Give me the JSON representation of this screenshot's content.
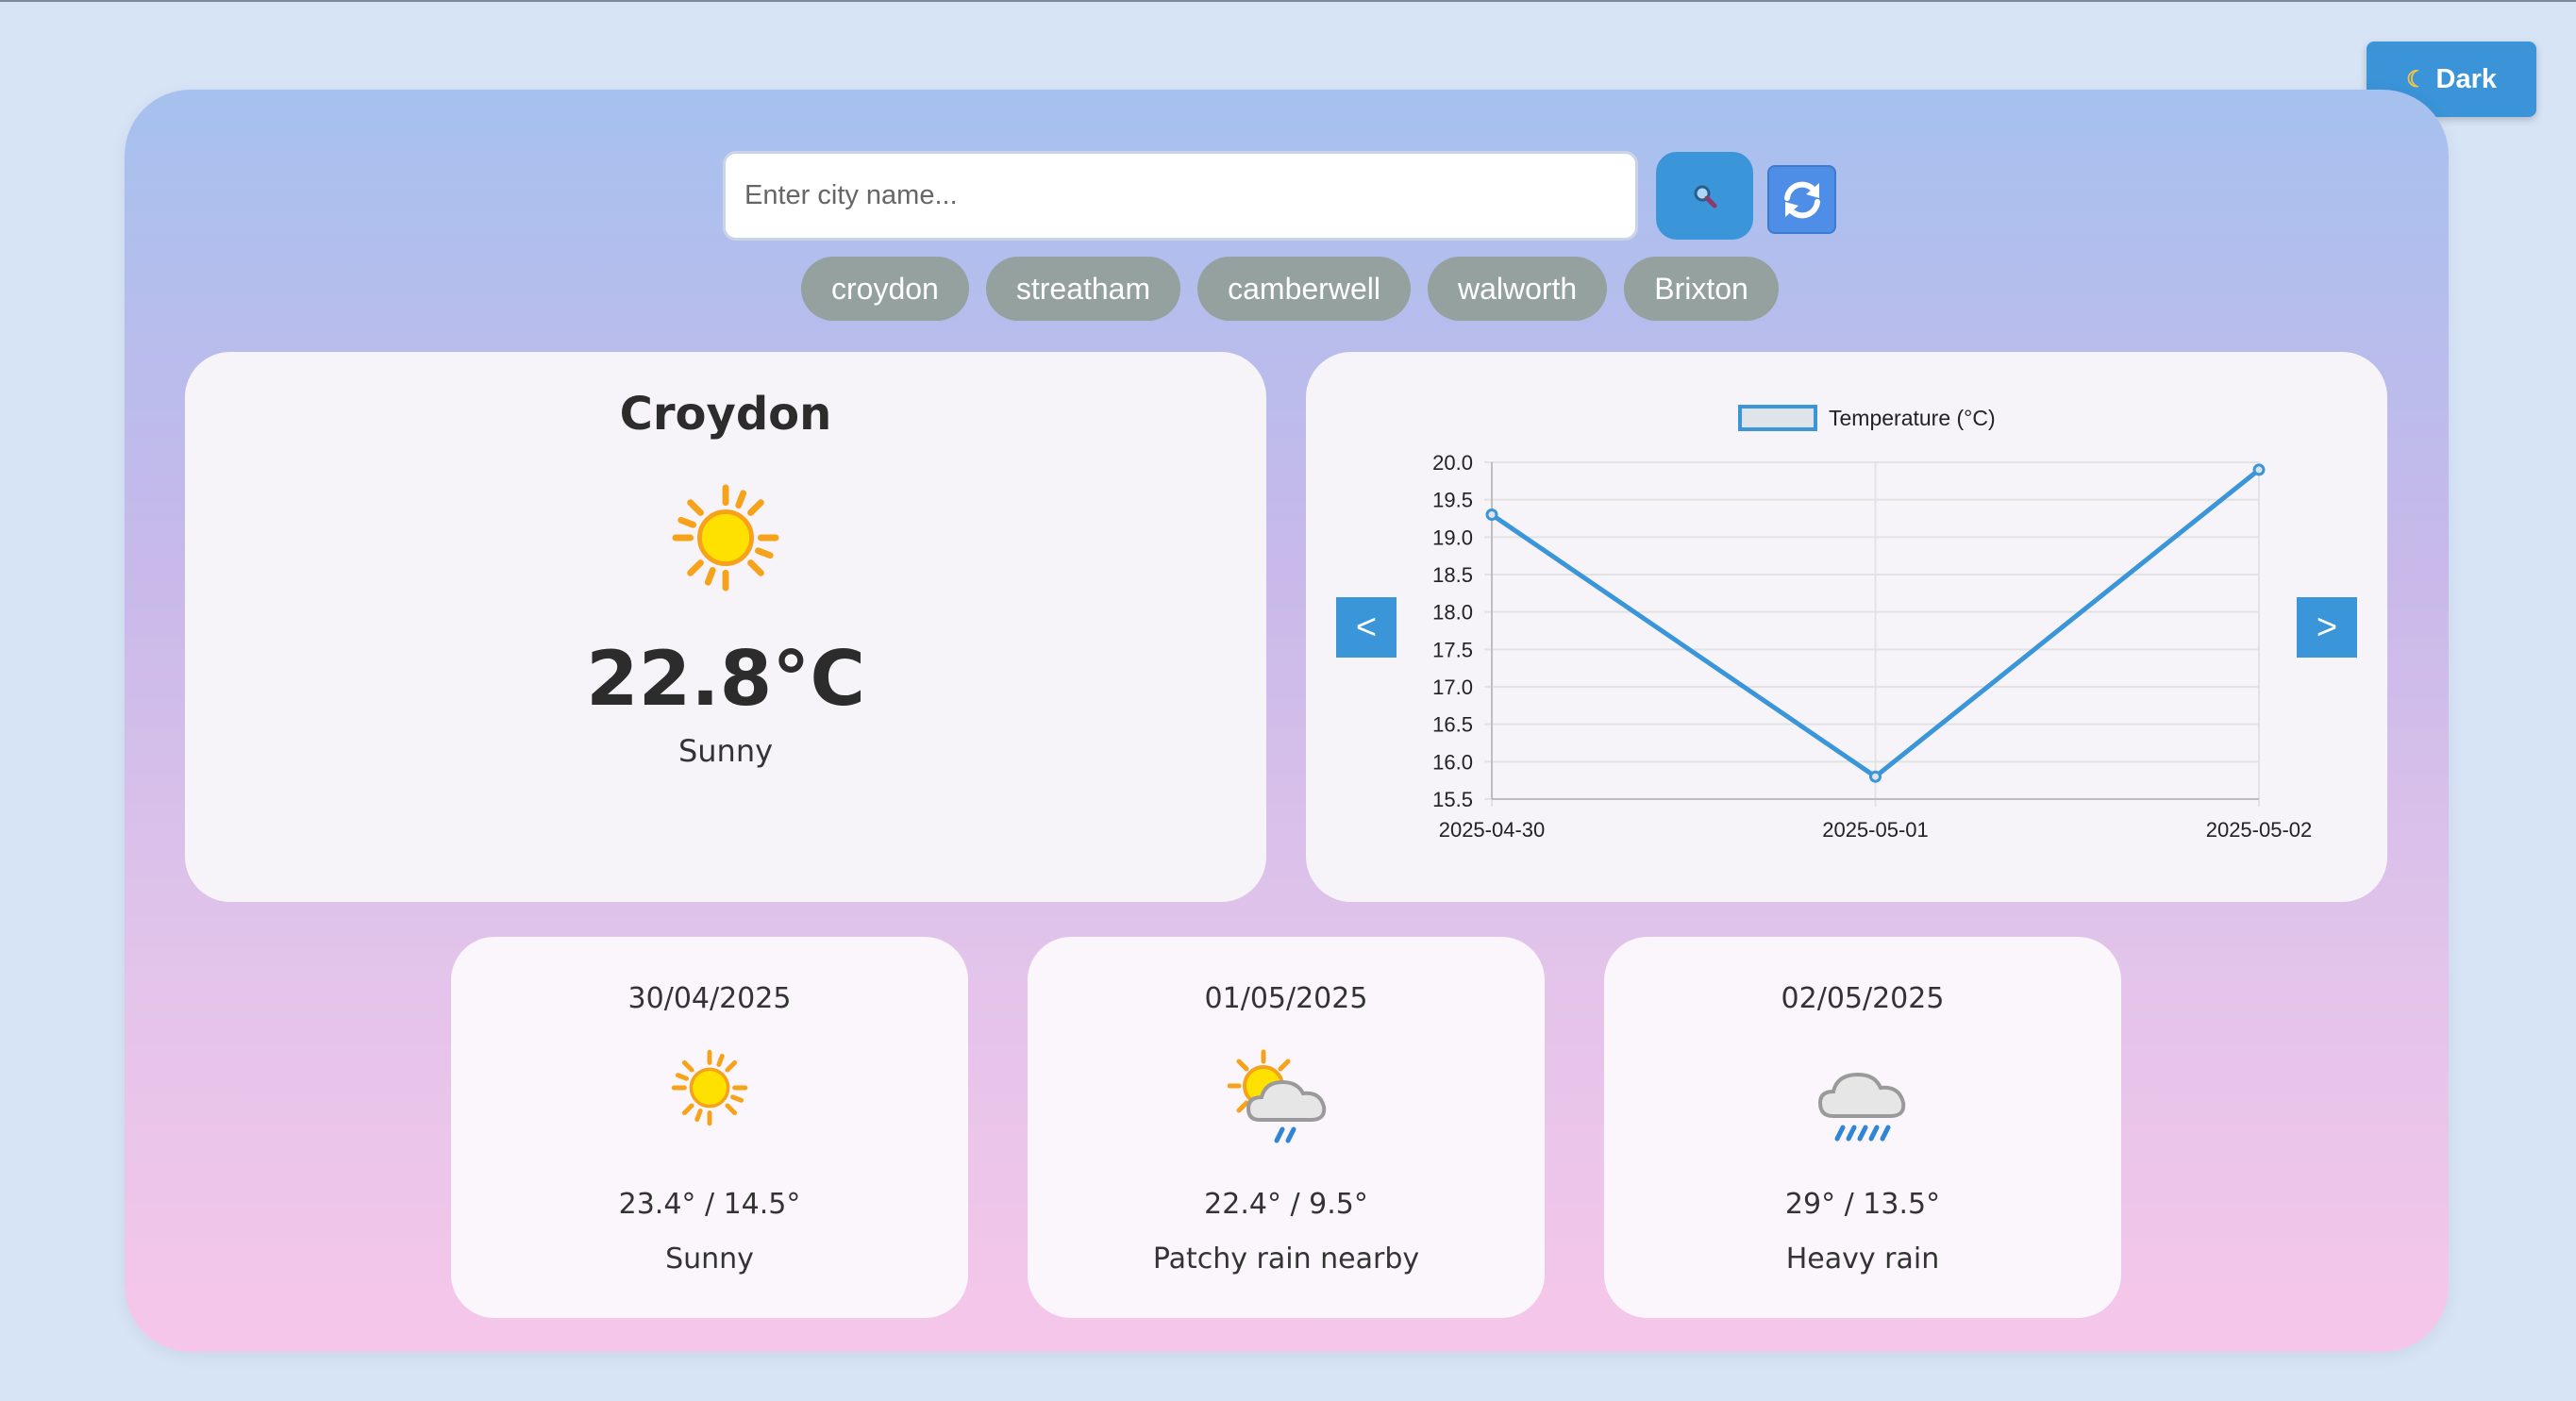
{
  "theme_toggle": {
    "icon": "moon-icon",
    "label": "Dark"
  },
  "search": {
    "placeholder": "Enter city name...",
    "value": "",
    "search_icon": "magnifier-icon",
    "refresh_icon": "refresh-icon"
  },
  "recent_cities": [
    "croydon",
    "streatham",
    "camberwell",
    "walworth",
    "Brixton"
  ],
  "current": {
    "city": "Croydon",
    "icon": "sun-icon",
    "temperature": "22.8°C",
    "condition": "Sunny"
  },
  "chart_nav": {
    "prev": "<",
    "next": ">"
  },
  "chart_data": {
    "type": "line",
    "x": [
      "2025-04-30",
      "2025-05-01",
      "2025-05-02"
    ],
    "series": [
      {
        "name": "Temperature (°C)",
        "values": [
          19.3,
          15.8,
          19.9
        ]
      }
    ],
    "ylim": [
      15.5,
      20.0
    ],
    "yticks": [
      "20.0",
      "19.5",
      "19.0",
      "18.5",
      "18.0",
      "17.5",
      "17.0",
      "16.5",
      "16.0",
      "15.5"
    ],
    "legend": "top",
    "grid": true,
    "colors": {
      "line": "#3a96d8",
      "grid": "#e2e2e2"
    }
  },
  "forecast": [
    {
      "date": "30/04/2025",
      "icon": "sun-icon",
      "temps": "23.4° / 14.5°",
      "condition": "Sunny"
    },
    {
      "date": "01/05/2025",
      "icon": "sun-cloud-rain-icon",
      "temps": "22.4° / 9.5°",
      "condition": "Patchy rain nearby"
    },
    {
      "date": "02/05/2025",
      "icon": "cloud-heavy-rain-icon",
      "temps": "29° / 13.5°",
      "condition": "Heavy rain"
    }
  ],
  "colors": {
    "accent": "#3a96d8",
    "chip": "#94a19f",
    "card": "#f6f4f9"
  }
}
